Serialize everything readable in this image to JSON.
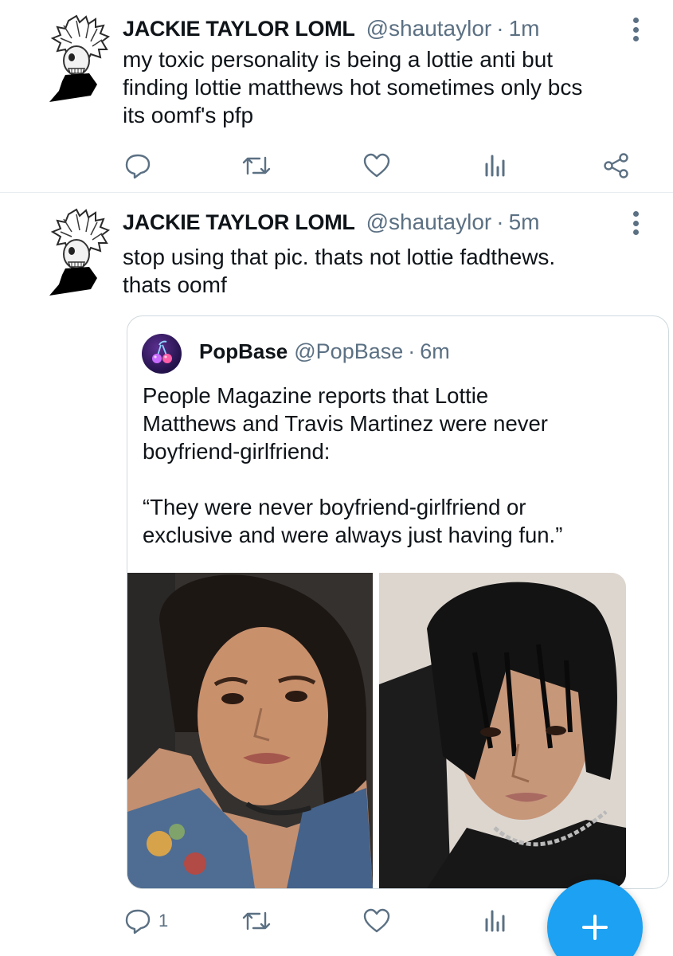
{
  "tweets": [
    {
      "author_name": "JACKIE TAYLOR LOML",
      "handle": "@shautaylor",
      "separator": "·",
      "time": "1m",
      "text": "my toxic personality is being a lottie anti but\nfinding lottie matthews hot sometimes only bcs\nits oomf's pfp",
      "reply_count": "",
      "avatar_icon": "avatar-skull-illustration"
    },
    {
      "author_name": "JACKIE TAYLOR LOML",
      "handle": "@shautaylor",
      "separator": "·",
      "time": "5m",
      "text": "stop using that pic. thats not lottie fadthews.\nthats oomf",
      "reply_count": "1",
      "avatar_icon": "avatar-skull-illustration",
      "quoted": {
        "author_name": "PopBase",
        "handle": "@PopBase",
        "separator": "·",
        "time": "6m",
        "text": "People Magazine reports that Lottie\nMatthews and Travis Martinez were never\nboyfriend-girlfriend:\n\n“They were never boyfriend-girlfriend or\nexclusive and were always just having fun.”",
        "avatar_icon": "cherry-logo-icon",
        "media_count": 2
      }
    }
  ],
  "icons": [
    "reply-icon",
    "retweet-icon",
    "like-icon",
    "stats-icon",
    "share-icon",
    "more-icon",
    "plus-icon"
  ],
  "colors": {
    "accent": "#1da1f2",
    "secondary_text": "#5b7083",
    "primary_text": "#0f1419",
    "divider": "#e6ecf0"
  },
  "fab": {
    "label": "+"
  }
}
